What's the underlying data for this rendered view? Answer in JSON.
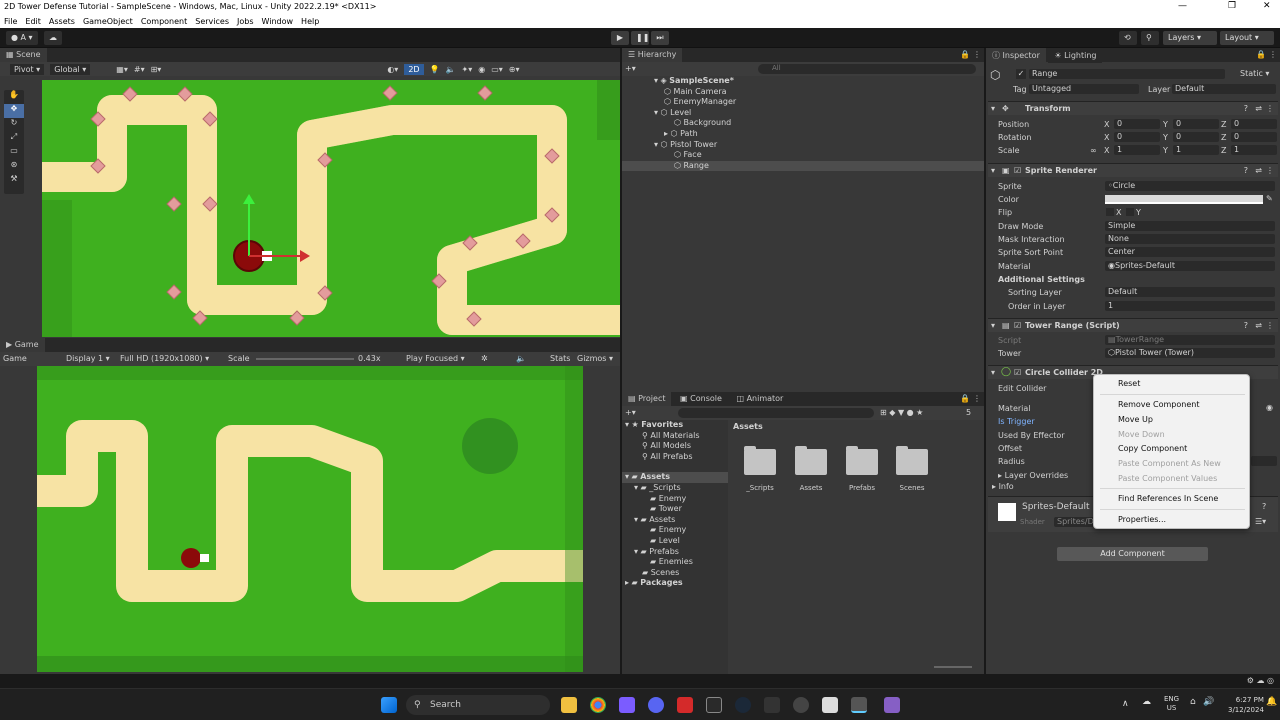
{
  "window": {
    "title": "2D Tower Defense Tutorial - SampleScene - Windows, Mac, Linux - Unity 2022.2.19* <DX11>"
  },
  "menu": [
    "File",
    "Edit",
    "Assets",
    "GameObject",
    "Component",
    "Services",
    "Jobs",
    "Window",
    "Help"
  ],
  "toolbar": {
    "account": "A",
    "layers": "Layers",
    "layout": "Layout"
  },
  "scene": {
    "tab": "Scene",
    "pivot": "Pivot",
    "global": "Global",
    "mode_2d": "2D"
  },
  "game": {
    "tab": "Game",
    "display": "Game",
    "display_num": "Display 1",
    "resolution": "Full HD (1920x1080)",
    "scale_label": "Scale",
    "scale_value": "0.43x",
    "play_focused": "Play Focused",
    "stats": "Stats",
    "gizmos": "Gizmos"
  },
  "hierarchy": {
    "tab": "Hierarchy",
    "search_placeholder": "All",
    "items": [
      {
        "label": "SampleScene*",
        "indent": 0
      },
      {
        "label": "Main Camera",
        "indent": 1
      },
      {
        "label": "EnemyManager",
        "indent": 1
      },
      {
        "label": "Level",
        "indent": 1
      },
      {
        "label": "Background",
        "indent": 2
      },
      {
        "label": "Path",
        "indent": 2
      },
      {
        "label": "Pistol Tower",
        "indent": 1
      },
      {
        "label": "Face",
        "indent": 2
      },
      {
        "label": "Range",
        "indent": 2
      }
    ]
  },
  "project": {
    "tabs": [
      "Project",
      "Console",
      "Animator"
    ],
    "favorites": "Favorites",
    "fav_items": [
      "All Materials",
      "All Models",
      "All Prefabs"
    ],
    "assets": "Assets",
    "tree": [
      {
        "label": "_Scripts",
        "indent": 1
      },
      {
        "label": "Enemy",
        "indent": 2
      },
      {
        "label": "Tower",
        "indent": 2
      },
      {
        "label": "Assets",
        "indent": 1
      },
      {
        "label": "Enemy",
        "indent": 2
      },
      {
        "label": "Level",
        "indent": 2
      },
      {
        "label": "Prefabs",
        "indent": 1
      },
      {
        "label": "Enemies",
        "indent": 2
      },
      {
        "label": "Scenes",
        "indent": 1
      }
    ],
    "packages": "Packages",
    "breadcrumb": "Assets",
    "folders": [
      "_Scripts",
      "Assets",
      "Prefabs",
      "Scenes"
    ],
    "hidden_count": "5"
  },
  "inspector": {
    "tabs": [
      "Inspector",
      "Lighting"
    ],
    "object_name": "Range",
    "static": "Static",
    "tag_label": "Tag",
    "tag": "Untagged",
    "layer_label": "Layer",
    "layer": "Default",
    "transform": {
      "header": "Transform",
      "position": "Position",
      "rotation": "Rotation",
      "scale": "Scale",
      "pos": [
        "0",
        "0",
        "0"
      ],
      "rot": [
        "0",
        "0",
        "0"
      ],
      "scl": [
        "1",
        "1",
        "1"
      ],
      "axes": [
        "X",
        "Y",
        "Z"
      ]
    },
    "sprite_renderer": {
      "header": "Sprite Renderer",
      "sprite_label": "Sprite",
      "sprite": "Circle",
      "color_label": "Color",
      "flip_label": "Flip",
      "flip_x": "X",
      "flip_y": "Y",
      "draw_mode_label": "Draw Mode",
      "draw_mode": "Simple",
      "mask_label": "Mask Interaction",
      "mask": "None",
      "sort_point_label": "Sprite Sort Point",
      "sort_point": "Center",
      "material_label": "Material",
      "material": "Sprites-Default",
      "additional": "Additional Settings",
      "sorting_layer_label": "Sorting Layer",
      "sorting_layer": "Default",
      "order_label": "Order in Layer",
      "order": "1"
    },
    "tower_range": {
      "header": "Tower Range (Script)",
      "script_label": "Script",
      "script": "TowerRange",
      "tower_label": "Tower",
      "tower": "Pistol Tower (Tower)"
    },
    "collider": {
      "header": "Circle Collider 2D",
      "edit_collider": "Edit Collider",
      "material": "Material",
      "is_trigger": "Is Trigger",
      "used_by_effector": "Used By Effector",
      "offset": "Offset",
      "radius": "Radius",
      "layer_overrides": "Layer Overrides",
      "info": "Info"
    },
    "material_block": {
      "name": "Sprites-Default (",
      "shader_label": "Shader",
      "shader": "Sprites/D"
    },
    "add_component": "Add Component"
  },
  "context_menu": {
    "items": [
      {
        "label": "Reset",
        "enabled": true
      },
      {
        "label": "Remove Component",
        "enabled": true
      },
      {
        "label": "Move Up",
        "enabled": true
      },
      {
        "label": "Move Down",
        "enabled": false
      },
      {
        "label": "Copy Component",
        "enabled": true
      },
      {
        "label": "Paste Component As New",
        "enabled": false
      },
      {
        "label": "Paste Component Values",
        "enabled": false
      },
      {
        "label": "Find References In Scene",
        "enabled": true
      },
      {
        "label": "Properties...",
        "enabled": true
      }
    ]
  },
  "taskbar": {
    "search": "Search",
    "lang": "ENG",
    "region": "US",
    "time": "6:27 PM",
    "date": "3/12/2024"
  },
  "colors": {
    "grass": "#3fb01f",
    "path": "#f7e3a4",
    "path_edge": "#e8c97e",
    "tower": "#8b0a0a",
    "diamond": "#e39c9c"
  }
}
